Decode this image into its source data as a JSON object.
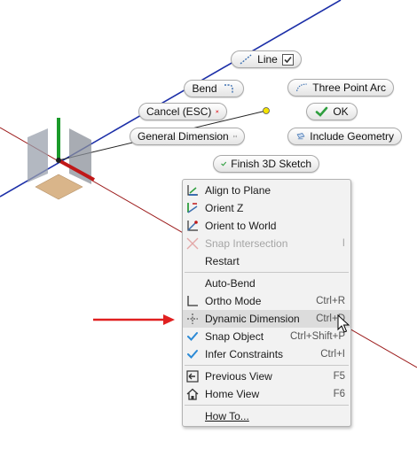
{
  "marking_menu": {
    "line": {
      "label": "Line",
      "checked": true
    },
    "bend": {
      "label": "Bend"
    },
    "three_point_arc": {
      "label": "Three Point Arc"
    },
    "cancel": {
      "label": "Cancel (ESC)"
    },
    "ok": {
      "label": "OK"
    },
    "general_dimension": {
      "label": "General Dimension"
    },
    "include_geometry": {
      "label": "Include Geometry"
    },
    "finish_3d_sketch": {
      "label": "Finish 3D Sketch"
    }
  },
  "context_menu": {
    "group1": [
      {
        "label": "Align to Plane",
        "icon": "align-plane-icon",
        "shortcut": "",
        "enabled": true
      },
      {
        "label": "Orient Z",
        "icon": "orient-z-icon",
        "shortcut": "",
        "enabled": true
      },
      {
        "label": "Orient to World",
        "icon": "orient-world-icon",
        "shortcut": "",
        "enabled": true
      },
      {
        "label": "Snap Intersection",
        "icon": "snap-intersection-icon",
        "shortcut": "I",
        "enabled": false
      },
      {
        "label": "Restart",
        "icon": "",
        "shortcut": "",
        "enabled": true
      }
    ],
    "group2": [
      {
        "label": "Auto-Bend",
        "icon": "",
        "shortcut": "",
        "enabled": true
      },
      {
        "label": "Ortho Mode",
        "icon": "ortho-mode-icon",
        "shortcut": "Ctrl+R",
        "enabled": true
      },
      {
        "label": "Dynamic Dimension",
        "icon": "dynamic-dimension-icon",
        "shortcut": "Ctrl+D",
        "enabled": true,
        "hovered": true
      },
      {
        "label": "Snap Object",
        "icon": "check-icon",
        "shortcut": "Ctrl+Shift+P",
        "enabled": true,
        "checked": true
      },
      {
        "label": "Infer Constraints",
        "icon": "check-icon",
        "shortcut": "Ctrl+I",
        "enabled": true,
        "checked": true
      }
    ],
    "group3": [
      {
        "label": "Previous View",
        "icon": "previous-view-icon",
        "shortcut": "F5",
        "enabled": true
      },
      {
        "label": "Home View",
        "icon": "home-view-icon",
        "shortcut": "F6",
        "enabled": true
      }
    ],
    "group4": [
      {
        "label": "How To...",
        "icon": "",
        "shortcut": "",
        "enabled": true
      }
    ]
  },
  "colors": {
    "axis_blue": "#1c2fa8",
    "axis_red": "#9c1b1b",
    "axis_green": "#1a9a2a",
    "annotation_arrow": "#e02020",
    "check_green": "#2e9e3e",
    "cancel_red": "#e0282f"
  }
}
